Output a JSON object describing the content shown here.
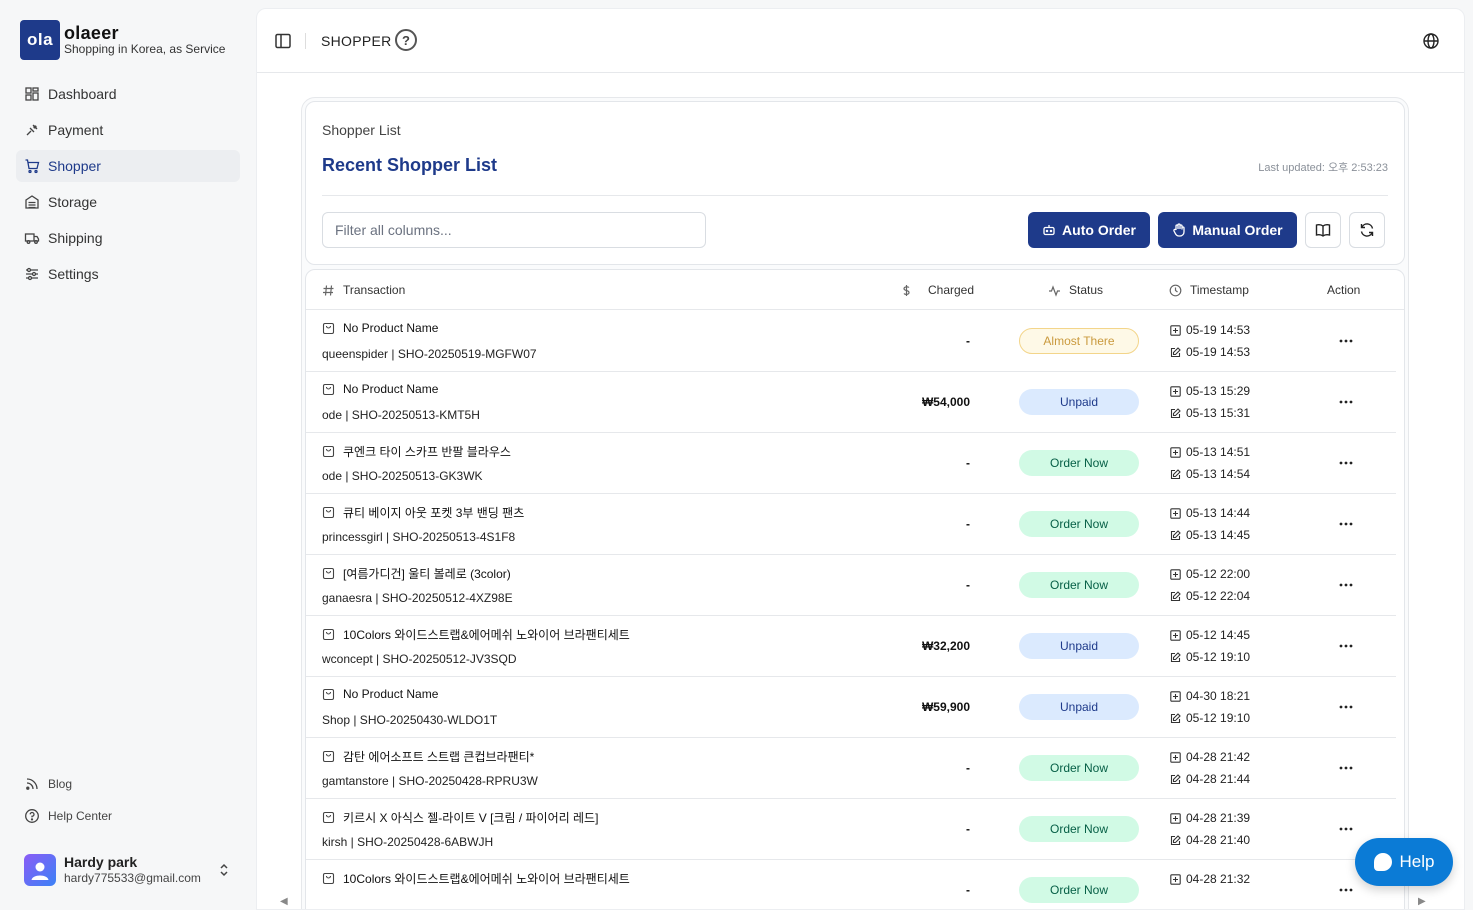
{
  "brand": {
    "logo_text": "ola",
    "name": "olaeer",
    "tagline": "Shopping in Korea, as Service"
  },
  "nav": [
    {
      "label": "Dashboard",
      "icon": "dashboard-icon"
    },
    {
      "label": "Payment",
      "icon": "payment-icon"
    },
    {
      "label": "Shopper",
      "icon": "cart-icon",
      "active": true
    },
    {
      "label": "Storage",
      "icon": "storage-icon"
    },
    {
      "label": "Shipping",
      "icon": "truck-icon"
    },
    {
      "label": "Settings",
      "icon": "sliders-icon"
    }
  ],
  "footer_links": {
    "blog": "Blog",
    "help_center": "Help Center"
  },
  "user": {
    "name": "Hardy park",
    "email": "hardy775533@gmail.com"
  },
  "topbar": {
    "title": "SHOPPER",
    "help_symbol": "?"
  },
  "card": {
    "subtitle": "Shopper List",
    "title": "Recent Shopper List",
    "updated": "Last updated: 오후 2:53:23",
    "filter_placeholder": "Filter all columns...",
    "auto_order": "Auto Order",
    "manual_order": "Manual Order"
  },
  "table": {
    "headers": {
      "transaction": "Transaction",
      "charged": "Charged",
      "status": "Status",
      "timestamp": "Timestamp",
      "action": "Action"
    },
    "rows": [
      {
        "name": "No Product Name",
        "sub": "queenspider | SHO-20250519-MGFW07",
        "charged": "-",
        "status": "Almost There",
        "kind": "almost",
        "created": "05-19 14:53",
        "updated": "05-19 14:53"
      },
      {
        "name": "No Product Name",
        "sub": "ode | SHO-20250513-KMT5H",
        "charged": "₩54,000",
        "status": "Unpaid",
        "kind": "unpaid",
        "created": "05-13 15:29",
        "updated": "05-13 15:31"
      },
      {
        "name": "쿠엔크 타이 스카프 반팔 블라우스",
        "sub": "ode | SHO-20250513-GK3WK",
        "charged": "-",
        "status": "Order Now",
        "kind": "order",
        "created": "05-13 14:51",
        "updated": "05-13 14:54"
      },
      {
        "name": "큐티 베이지 아웃 포켓 3부 밴딩 팬츠",
        "sub": "princessgirl | SHO-20250513-4S1F8",
        "charged": "-",
        "status": "Order Now",
        "kind": "order",
        "created": "05-13 14:44",
        "updated": "05-13 14:45"
      },
      {
        "name": "[여름가디건] 울티 볼레로 (3color)",
        "sub": "ganaesra | SHO-20250512-4XZ98E",
        "charged": "-",
        "status": "Order Now",
        "kind": "order",
        "created": "05-12 22:00",
        "updated": "05-12 22:04"
      },
      {
        "name": "10Colors 와이드스트랩&에어메쉬 노와이어 브라팬티세트",
        "sub": "wconcept | SHO-20250512-JV3SQD",
        "charged": "₩32,200",
        "status": "Unpaid",
        "kind": "unpaid",
        "created": "05-12 14:45",
        "updated": "05-12 19:10"
      },
      {
        "name": "No Product Name",
        "sub": "Shop | SHO-20250430-WLDO1T",
        "charged": "₩59,900",
        "status": "Unpaid",
        "kind": "unpaid",
        "created": "04-30 18:21",
        "updated": "05-12 19:10"
      },
      {
        "name": "감탄 에어소프트 스트랩 큰컵브라팬티*",
        "sub": "gamtanstore | SHO-20250428-RPRU3W",
        "charged": "-",
        "status": "Order Now",
        "kind": "order",
        "created": "04-28 21:42",
        "updated": "04-28 21:44"
      },
      {
        "name": "키르시 X 아식스 젤-라이트 V [크림 / 파이어리 레드]",
        "sub": "kirsh | SHO-20250428-6ABWJH",
        "charged": "-",
        "status": "Order Now",
        "kind": "order",
        "created": "04-28 21:39",
        "updated": "04-28 21:40"
      },
      {
        "name": "10Colors 와이드스트랩&에어메쉬 노와이어 브라팬티세트",
        "sub": "",
        "charged": "-",
        "status": "Order Now",
        "kind": "order",
        "created": "04-28 21:32",
        "updated": ""
      }
    ]
  },
  "help_button": "Help",
  "colors": {
    "brand": "#1e3a8a",
    "help": "#0b7bd6",
    "unpaid_bg": "#dbeafe",
    "order_bg": "#d1fae5",
    "almost_bg": "#fef9e7"
  }
}
